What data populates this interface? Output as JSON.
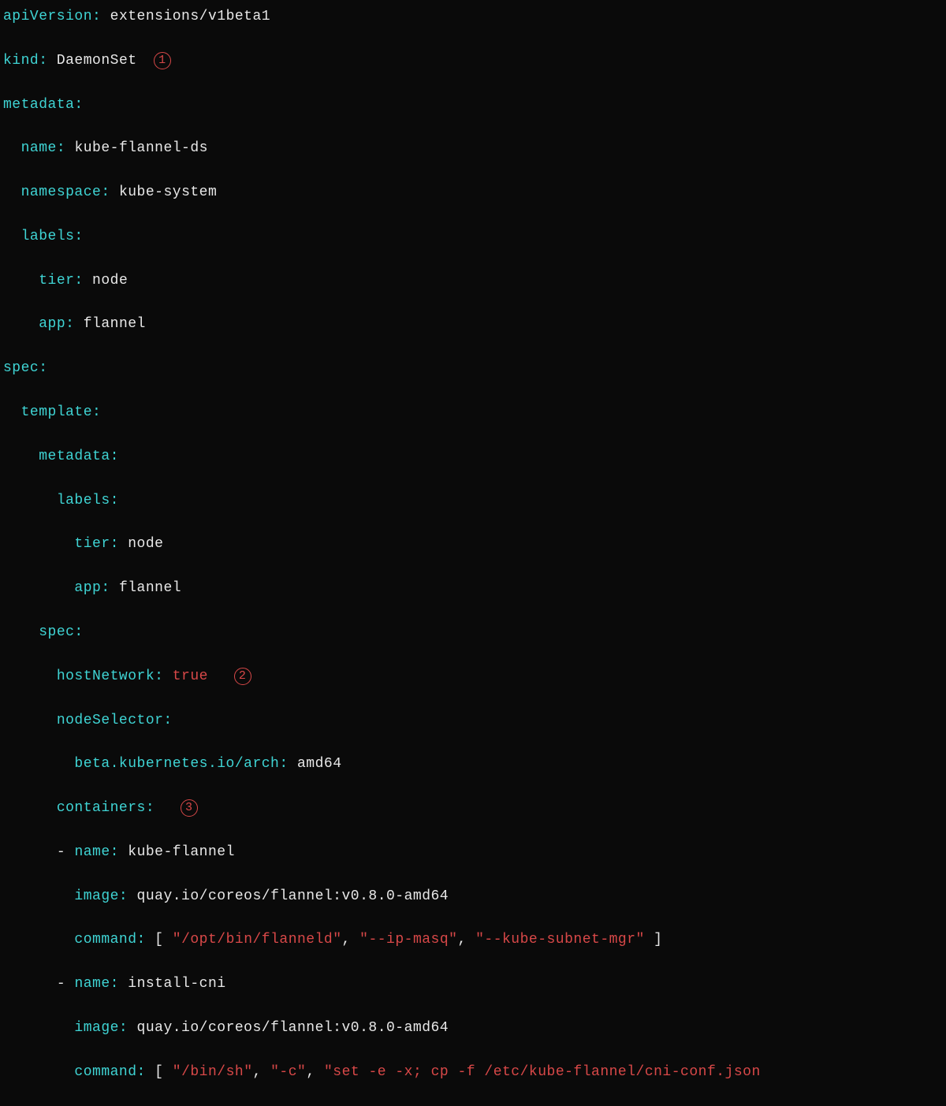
{
  "yaml": {
    "apiVersion_key": "apiVersion:",
    "apiVersion_val": "extensions/v1beta1",
    "kind_key": "kind:",
    "kind_val": "DaemonSet",
    "metadata_key": "metadata:",
    "name_key": "name:",
    "name_val": "kube-flannel-ds",
    "namespace_key": "namespace:",
    "namespace_val": "kube-system",
    "labels_key": "labels:",
    "tier_key": "tier:",
    "tier_val": "node",
    "app_key": "app:",
    "app_val": "flannel",
    "spec_key": "spec:",
    "template_key": "template:",
    "hostNetwork_key": "hostNetwork:",
    "hostNetwork_val": "true",
    "nodeSelector_key": "nodeSelector:",
    "arch_key": "beta.kubernetes.io/arch:",
    "arch_val": "amd64",
    "containers_key": "containers:",
    "dash": "-",
    "c1_name_val": "kube-flannel",
    "image_key": "image:",
    "c1_image_val": "quay.io/coreos/flannel:v0.8.0-amd64",
    "command_key": "command:",
    "lbr": "[",
    "rbr": "]",
    "comma": ",",
    "c1_cmd_a": "\"/opt/bin/flanneld\"",
    "c1_cmd_b": "\"--ip-masq\"",
    "c1_cmd_c": "\"--kube-subnet-mgr\"",
    "c2_name_val": "install-cni",
    "c2_image_val": "quay.io/coreos/flannel:v0.8.0-amd64",
    "c2_cmd_a": "\"/bin/sh\"",
    "c2_cmd_b": "\"-c\"",
    "c2_cmd_c": "\"set -e -x; cp -f /etc/kube-flannel/cni-conf.json"
  },
  "markers": {
    "m1": "1",
    "m2": "2",
    "m3": "3"
  },
  "indent": {
    "i1": "  ",
    "i2": "    ",
    "i3": "      ",
    "i4": "        "
  }
}
